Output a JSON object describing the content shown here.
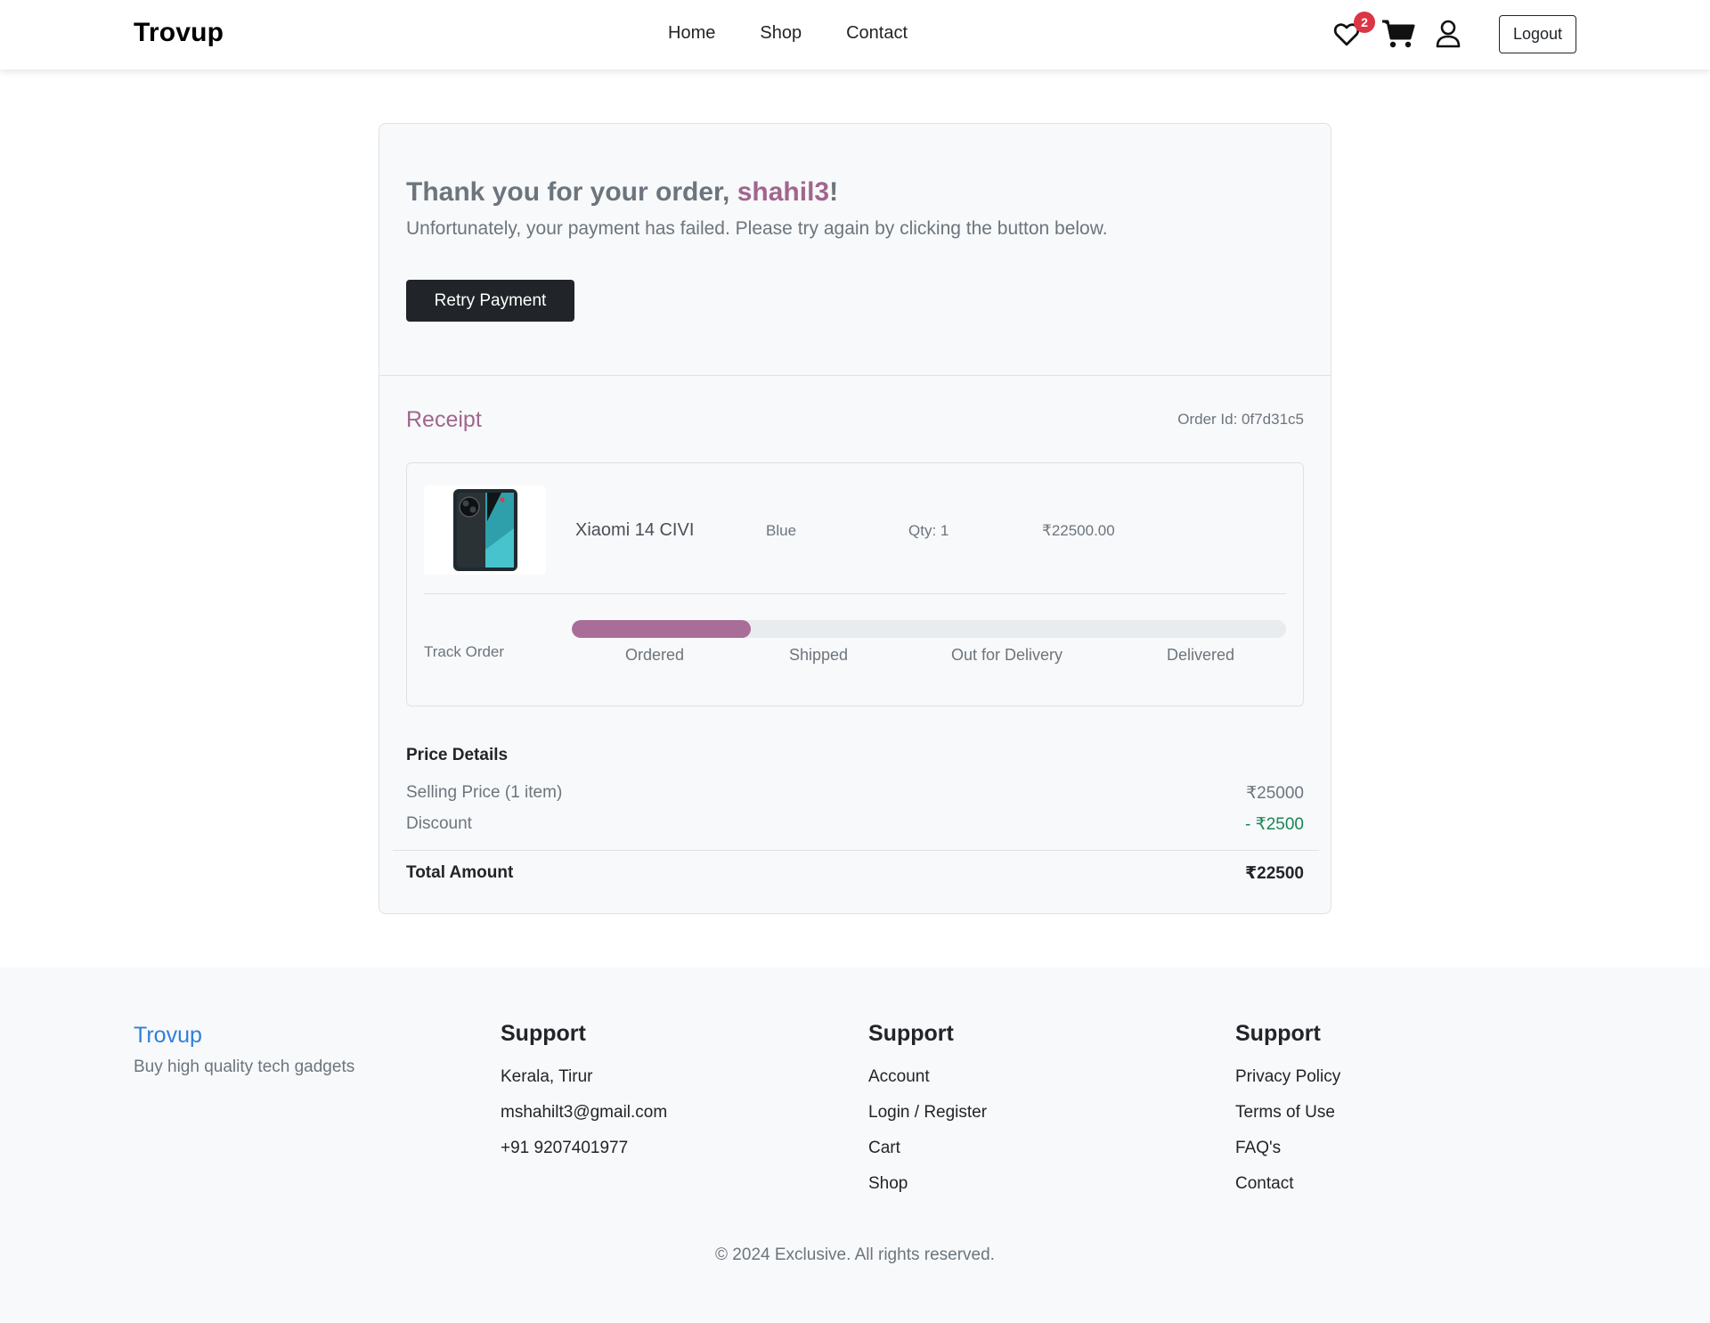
{
  "nav": {
    "brand": "Trovup",
    "links": [
      "Home",
      "Shop",
      "Contact"
    ],
    "wishlist_count": "2",
    "logout": "Logout"
  },
  "order": {
    "thank_prefix": "Thank you for your order, ",
    "username": "shahil3",
    "thank_suffix": "!",
    "fail_message": "Unfortunately, your payment has failed. Please try again by clicking the button below.",
    "retry_label": "Retry Payment"
  },
  "receipt": {
    "title": "Receipt",
    "order_id": "Order Id: 0f7d31c5",
    "item": {
      "name": "Xiaomi 14 CIVI",
      "color": "Blue",
      "qty": "Qty: 1",
      "price": "₹22500.00"
    },
    "track_label": "Track Order",
    "progress_percent": 25,
    "steps": [
      "Ordered",
      "Shipped",
      "Out for Delivery",
      "Delivered"
    ]
  },
  "price_details": {
    "title": "Price Details",
    "selling_label": "Selling Price (1 item)",
    "selling_value": "₹25000",
    "discount_label": "Discount",
    "discount_value": "- ₹2500",
    "total_label": "Total Amount",
    "total_value": "₹22500"
  },
  "footer": {
    "brand": "Trovup",
    "tagline": "Buy high quality tech gadgets",
    "col1": {
      "title": "Support",
      "items": [
        "Kerala, Tirur",
        "mshahilt3@gmail.com",
        "+91 9207401977"
      ]
    },
    "col2": {
      "title": "Support",
      "items": [
        "Account",
        "Login / Register",
        "Cart",
        "Shop"
      ]
    },
    "col3": {
      "title": "Support",
      "items": [
        "Privacy Policy",
        "Terms of Use",
        "FAQ's",
        "Contact"
      ]
    },
    "copyright": "© 2024 Exclusive. All rights reserved."
  },
  "colors": {
    "accent": "#a0668f",
    "progress": "#a86e98",
    "discount": "#198754",
    "footer_brand": "#2f7fdc",
    "badge": "#dc3545"
  }
}
